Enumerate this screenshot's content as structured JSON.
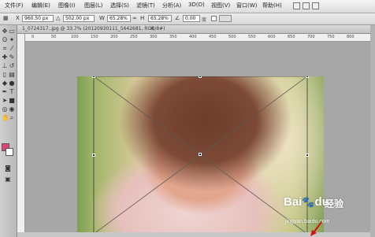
{
  "menubar": {
    "items": [
      "文件(F)",
      "编辑(E)",
      "图像(I)",
      "图层(L)",
      "选择(S)",
      "滤镜(T)",
      "分析(A)",
      "3D(D)",
      "视图(V)",
      "窗口(W)",
      "帮助(H)"
    ]
  },
  "options": {
    "width_value": "960.50 px",
    "height_value": "502.00 px",
    "w_scale": "65.28%",
    "h_scale": "65.28%",
    "angle": "0.00",
    "angle_unit": "度"
  },
  "document": {
    "tab_title": "1_0724317..jpg @ 33.7% (20120930111_5642681, RGB/8#)",
    "ruler_ticks": [
      "0",
      "50",
      "100",
      "150",
      "200",
      "250",
      "300",
      "350",
      "400",
      "450",
      "500",
      "550",
      "600",
      "650",
      "700",
      "750",
      "800"
    ]
  },
  "toolbox": {
    "foreground_color": "#e4417a",
    "background_color": "#ffffff"
  },
  "watermark": {
    "logo": "Bai",
    "logo_suffix": "du",
    "chinese": "经验",
    "url": "jingyan.baidu.com"
  },
  "colors": {
    "accent_arrow": "#d41414",
    "transform_line": "#5a5a5a"
  }
}
